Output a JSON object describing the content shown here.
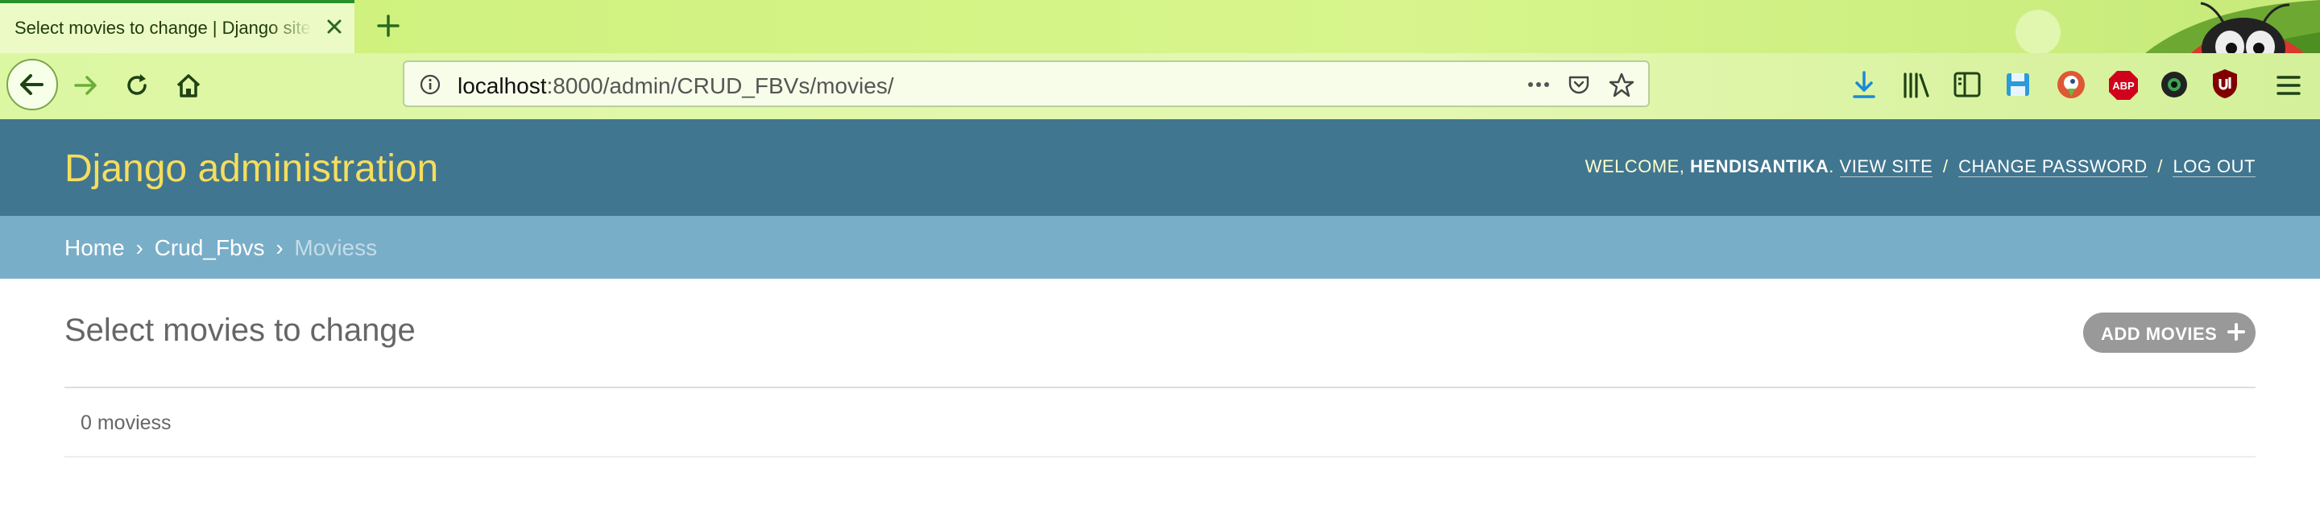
{
  "browser": {
    "tab_title": "Select movies to change | Django site admin",
    "url_host": "localhost",
    "url_rest": ":8000/admin/CRUD_FBVs/movies/"
  },
  "header": {
    "branding": "Django administration",
    "welcome": "Welcome,",
    "username": "hendisantika",
    "view_site": "View site",
    "change_password": "Change password",
    "log_out": "Log out",
    "separator": "/"
  },
  "breadcrumbs": {
    "home": "Home",
    "app": "Crud_Fbvs",
    "current": "Moviess",
    "arrow": "›"
  },
  "content": {
    "title": "Select movies to change",
    "add_button": "ADD MOVIES",
    "result_count": "0 moviess"
  },
  "extensions": {
    "abp_label": "ABP"
  },
  "colors": {
    "header_bg": "#417690",
    "branding": "#f5dd5d",
    "breadcrumbs_bg": "#79aec8",
    "add_button_bg": "#999999"
  }
}
